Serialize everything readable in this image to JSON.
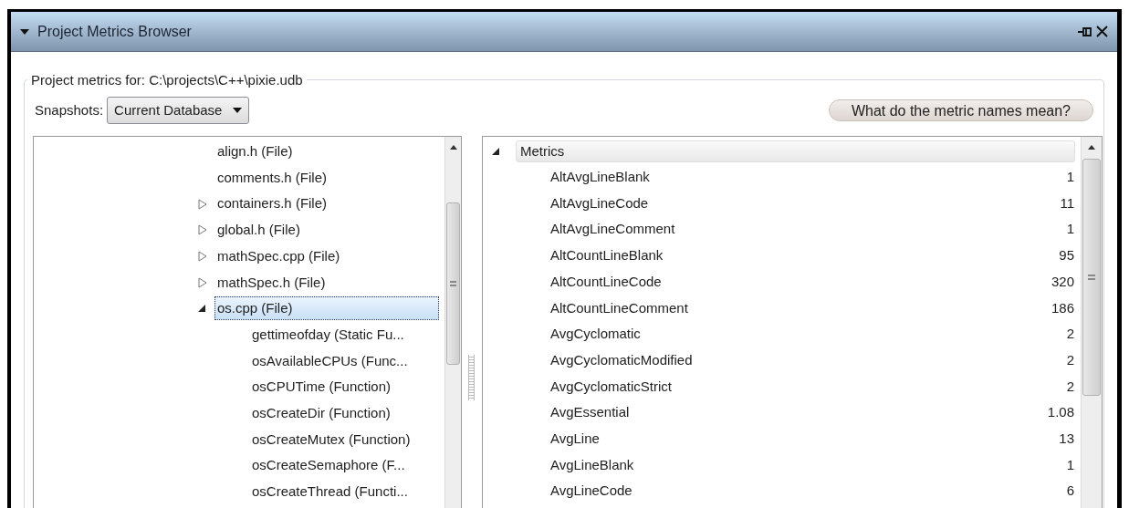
{
  "panel": {
    "title": "Project Metrics Browser"
  },
  "group_title": "Project metrics for: C:\\projects\\C++\\pixie.udb",
  "snapshots": {
    "label": "Snapshots:",
    "value": "Current Database"
  },
  "help_button": "What do the metric names mean?",
  "tree": {
    "items": [
      {
        "label": "align.h (File)",
        "kind": "leaf",
        "selected": false
      },
      {
        "label": "comments.h (File)",
        "kind": "leaf",
        "selected": false
      },
      {
        "label": "containers.h (File)",
        "kind": "branch",
        "expanded": false,
        "selected": false
      },
      {
        "label": "global.h (File)",
        "kind": "branch",
        "expanded": false,
        "selected": false
      },
      {
        "label": "mathSpec.cpp (File)",
        "kind": "branch",
        "expanded": false,
        "selected": false
      },
      {
        "label": "mathSpec.h (File)",
        "kind": "branch",
        "expanded": false,
        "selected": false
      },
      {
        "label": "os.cpp (File)",
        "kind": "branch",
        "expanded": true,
        "selected": true,
        "children": [
          {
            "label": "gettimeofday (Static Fu...",
            "selected": false
          },
          {
            "label": "osAvailableCPUs (Func...",
            "selected": false
          },
          {
            "label": "osCPUTime (Function)",
            "selected": false
          },
          {
            "label": "osCreateDir (Function)",
            "selected": false
          },
          {
            "label": "osCreateMutex (Function)",
            "selected": false
          },
          {
            "label": "osCreateSemaphore (F...",
            "selected": false
          },
          {
            "label": "osCreateThread (Functi...",
            "selected": false
          }
        ]
      }
    ]
  },
  "metrics": {
    "label": "Metrics",
    "expanded": true,
    "rows": [
      {
        "name": "AltAvgLineBlank",
        "value": "1"
      },
      {
        "name": "AltAvgLineCode",
        "value": "11"
      },
      {
        "name": "AltAvgLineComment",
        "value": "1"
      },
      {
        "name": "AltCountLineBlank",
        "value": "95"
      },
      {
        "name": "AltCountLineCode",
        "value": "320"
      },
      {
        "name": "AltCountLineComment",
        "value": "186"
      },
      {
        "name": "AvgCyclomatic",
        "value": "2"
      },
      {
        "name": "AvgCyclomaticModified",
        "value": "2"
      },
      {
        "name": "AvgCyclomaticStrict",
        "value": "2"
      },
      {
        "name": "AvgEssential",
        "value": "1.08"
      },
      {
        "name": "AvgLine",
        "value": "13"
      },
      {
        "name": "AvgLineBlank",
        "value": "1"
      },
      {
        "name": "AvgLineCode",
        "value": "6"
      }
    ]
  }
}
